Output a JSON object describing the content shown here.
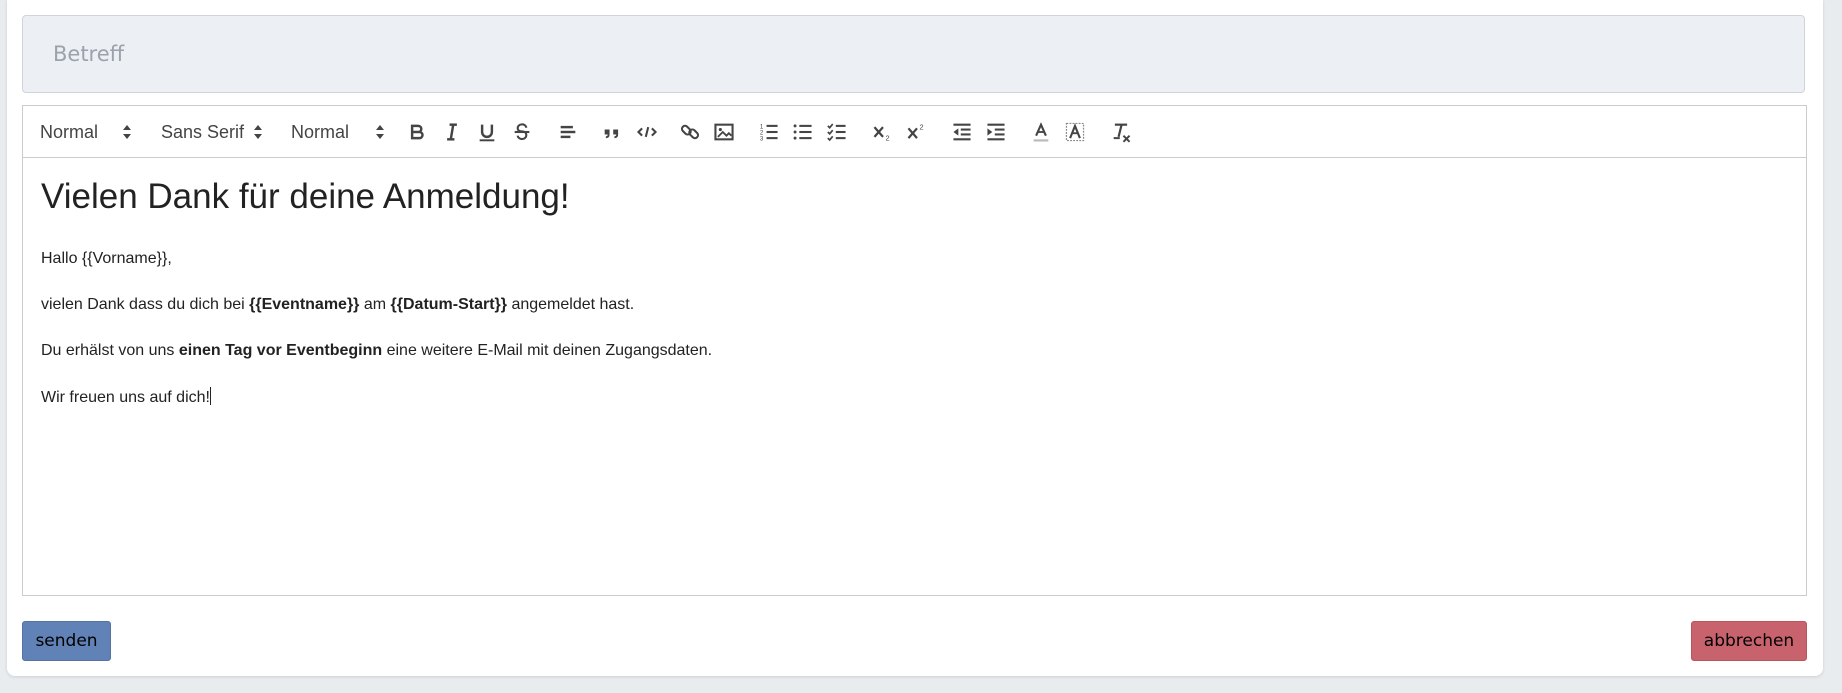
{
  "subject": {
    "placeholder": "Betreff",
    "value": ""
  },
  "toolbar": {
    "header_picker": "Normal",
    "font_picker": "Sans Serif",
    "size_picker": "Normal",
    "buttons": [
      "bold-icon",
      "italic-icon",
      "underline-icon",
      "strikethrough-icon",
      "align-left-icon",
      "blockquote-icon",
      "code-icon",
      "link-icon",
      "image-icon",
      "ordered-list-icon",
      "bullet-list-icon",
      "checklist-icon",
      "subscript-icon",
      "superscript-icon",
      "outdent-icon",
      "indent-icon",
      "text-color-icon",
      "background-color-icon",
      "clear-format-icon"
    ]
  },
  "content": {
    "heading": "Vielen Dank für deine Anmeldung!",
    "p1": "Hallo {{Vorname}},",
    "p2_a": "vielen Dank dass du dich bei ",
    "p2_b": "{{Eventname}}",
    "p2_c": " am ",
    "p2_d": "{{Datum-Start}}",
    "p2_e": " angemeldet hast.",
    "p3_a": "Du erhälst von uns ",
    "p3_b": "einen Tag vor Eventbeginn",
    "p3_c": " eine weitere E-Mail mit deinen Zugangsdaten.",
    "p4": "Wir freuen uns auf dich!"
  },
  "actions": {
    "send_label": "senden",
    "cancel_label": "abbrechen"
  },
  "colors": {
    "send_button": "#6082b6",
    "cancel_button": "#c8636e",
    "subject_bg": "#eceff3"
  }
}
